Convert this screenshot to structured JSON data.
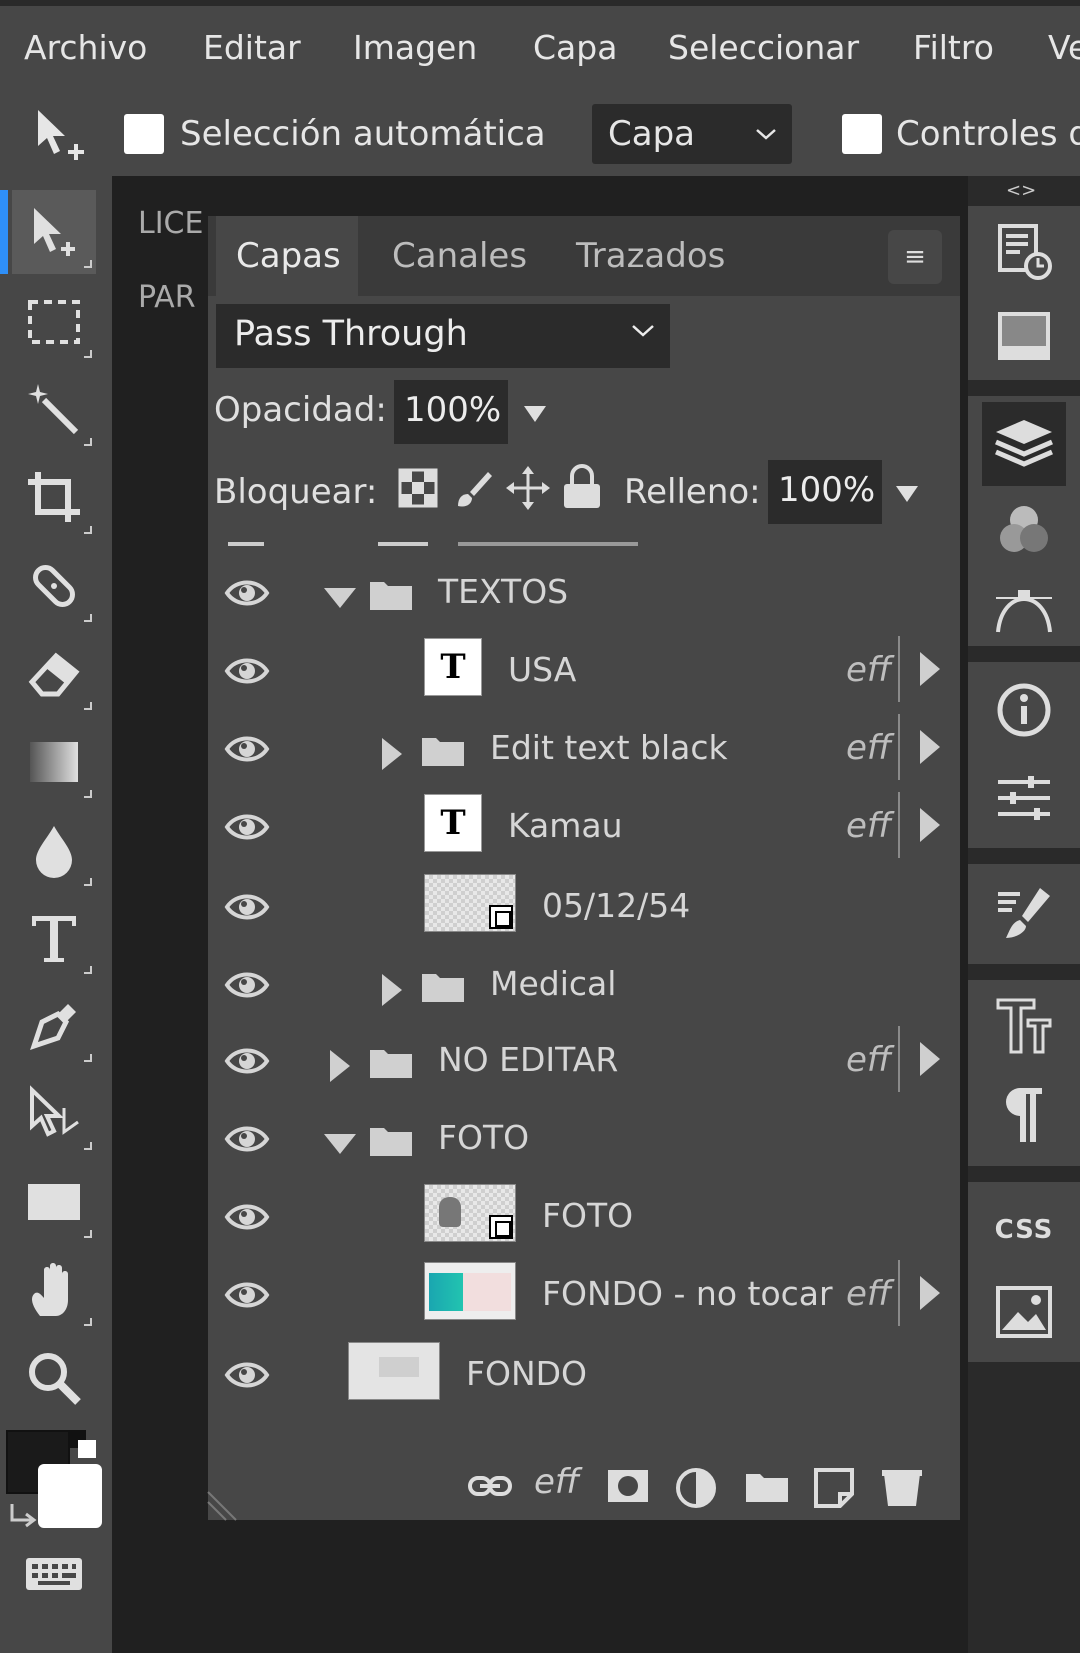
{
  "menu": {
    "items": [
      "Archivo",
      "Editar",
      "Imagen",
      "Capa",
      "Seleccionar",
      "Filtro",
      "Ve"
    ]
  },
  "options": {
    "auto_select_label": "Selección automática",
    "target_select_value": "Capa",
    "controls_label": "Controles d"
  },
  "canvas_text": {
    "line1": "LICE",
    "line2": "PAR"
  },
  "panel": {
    "tabs": [
      "Capas",
      "Canales",
      "Trazados"
    ],
    "menu_glyph": "≡",
    "blend_mode": "Pass Through",
    "opacity_label": "Opacidad:",
    "opacity_value": "100%",
    "lock_label": "Bloquear:",
    "fill_label": "Relleno:",
    "fill_value": "100%",
    "eff_label": "eff"
  },
  "layers": [
    {
      "name": "TEXTOS",
      "type": "group",
      "expanded": true,
      "indent": 1,
      "eff": false
    },
    {
      "name": "USA",
      "type": "text",
      "indent": 2,
      "eff": true
    },
    {
      "name": "Edit text black",
      "type": "group",
      "expanded": false,
      "indent": 2,
      "eff": true
    },
    {
      "name": "Kamau",
      "type": "text",
      "indent": 2,
      "eff": true
    },
    {
      "name": "05/12/54",
      "type": "smart",
      "indent": 2,
      "eff": false
    },
    {
      "name": "Medical",
      "type": "group",
      "expanded": false,
      "indent": 2,
      "eff": false
    },
    {
      "name": "NO EDITAR",
      "type": "group",
      "expanded": false,
      "indent": 1,
      "eff": true
    },
    {
      "name": "FOTO",
      "type": "group",
      "expanded": true,
      "indent": 1,
      "eff": false
    },
    {
      "name": "FOTO",
      "type": "smart-photo",
      "indent": 2,
      "eff": false
    },
    {
      "name": "FONDO - no tocar",
      "type": "image-teal",
      "indent": 2,
      "eff": true
    },
    {
      "name": "FONDO",
      "type": "image-bg",
      "indent": 1,
      "eff": false
    }
  ],
  "bottom_bar": {
    "eff_label": "eff"
  },
  "right_panel": {
    "css_label": "CSS"
  },
  "colors": {
    "foreground": "#1a1a1a",
    "background": "#ffffff",
    "accent": "#2f8ff7"
  }
}
